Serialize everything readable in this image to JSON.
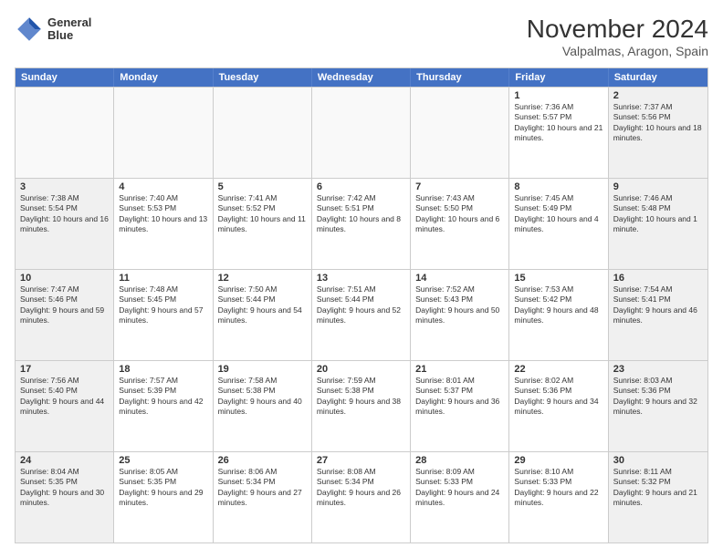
{
  "header": {
    "logo_line1": "General",
    "logo_line2": "Blue",
    "month_title": "November 2024",
    "location": "Valpalmas, Aragon, Spain"
  },
  "weekdays": [
    "Sunday",
    "Monday",
    "Tuesday",
    "Wednesday",
    "Thursday",
    "Friday",
    "Saturday"
  ],
  "rows": [
    [
      {
        "day": "",
        "info": ""
      },
      {
        "day": "",
        "info": ""
      },
      {
        "day": "",
        "info": ""
      },
      {
        "day": "",
        "info": ""
      },
      {
        "day": "",
        "info": ""
      },
      {
        "day": "1",
        "info": "Sunrise: 7:36 AM\nSunset: 5:57 PM\nDaylight: 10 hours and 21 minutes."
      },
      {
        "day": "2",
        "info": "Sunrise: 7:37 AM\nSunset: 5:56 PM\nDaylight: 10 hours and 18 minutes."
      }
    ],
    [
      {
        "day": "3",
        "info": "Sunrise: 7:38 AM\nSunset: 5:54 PM\nDaylight: 10 hours and 16 minutes."
      },
      {
        "day": "4",
        "info": "Sunrise: 7:40 AM\nSunset: 5:53 PM\nDaylight: 10 hours and 13 minutes."
      },
      {
        "day": "5",
        "info": "Sunrise: 7:41 AM\nSunset: 5:52 PM\nDaylight: 10 hours and 11 minutes."
      },
      {
        "day": "6",
        "info": "Sunrise: 7:42 AM\nSunset: 5:51 PM\nDaylight: 10 hours and 8 minutes."
      },
      {
        "day": "7",
        "info": "Sunrise: 7:43 AM\nSunset: 5:50 PM\nDaylight: 10 hours and 6 minutes."
      },
      {
        "day": "8",
        "info": "Sunrise: 7:45 AM\nSunset: 5:49 PM\nDaylight: 10 hours and 4 minutes."
      },
      {
        "day": "9",
        "info": "Sunrise: 7:46 AM\nSunset: 5:48 PM\nDaylight: 10 hours and 1 minute."
      }
    ],
    [
      {
        "day": "10",
        "info": "Sunrise: 7:47 AM\nSunset: 5:46 PM\nDaylight: 9 hours and 59 minutes."
      },
      {
        "day": "11",
        "info": "Sunrise: 7:48 AM\nSunset: 5:45 PM\nDaylight: 9 hours and 57 minutes."
      },
      {
        "day": "12",
        "info": "Sunrise: 7:50 AM\nSunset: 5:44 PM\nDaylight: 9 hours and 54 minutes."
      },
      {
        "day": "13",
        "info": "Sunrise: 7:51 AM\nSunset: 5:44 PM\nDaylight: 9 hours and 52 minutes."
      },
      {
        "day": "14",
        "info": "Sunrise: 7:52 AM\nSunset: 5:43 PM\nDaylight: 9 hours and 50 minutes."
      },
      {
        "day": "15",
        "info": "Sunrise: 7:53 AM\nSunset: 5:42 PM\nDaylight: 9 hours and 48 minutes."
      },
      {
        "day": "16",
        "info": "Sunrise: 7:54 AM\nSunset: 5:41 PM\nDaylight: 9 hours and 46 minutes."
      }
    ],
    [
      {
        "day": "17",
        "info": "Sunrise: 7:56 AM\nSunset: 5:40 PM\nDaylight: 9 hours and 44 minutes."
      },
      {
        "day": "18",
        "info": "Sunrise: 7:57 AM\nSunset: 5:39 PM\nDaylight: 9 hours and 42 minutes."
      },
      {
        "day": "19",
        "info": "Sunrise: 7:58 AM\nSunset: 5:38 PM\nDaylight: 9 hours and 40 minutes."
      },
      {
        "day": "20",
        "info": "Sunrise: 7:59 AM\nSunset: 5:38 PM\nDaylight: 9 hours and 38 minutes."
      },
      {
        "day": "21",
        "info": "Sunrise: 8:01 AM\nSunset: 5:37 PM\nDaylight: 9 hours and 36 minutes."
      },
      {
        "day": "22",
        "info": "Sunrise: 8:02 AM\nSunset: 5:36 PM\nDaylight: 9 hours and 34 minutes."
      },
      {
        "day": "23",
        "info": "Sunrise: 8:03 AM\nSunset: 5:36 PM\nDaylight: 9 hours and 32 minutes."
      }
    ],
    [
      {
        "day": "24",
        "info": "Sunrise: 8:04 AM\nSunset: 5:35 PM\nDaylight: 9 hours and 30 minutes."
      },
      {
        "day": "25",
        "info": "Sunrise: 8:05 AM\nSunset: 5:35 PM\nDaylight: 9 hours and 29 minutes."
      },
      {
        "day": "26",
        "info": "Sunrise: 8:06 AM\nSunset: 5:34 PM\nDaylight: 9 hours and 27 minutes."
      },
      {
        "day": "27",
        "info": "Sunrise: 8:08 AM\nSunset: 5:34 PM\nDaylight: 9 hours and 26 minutes."
      },
      {
        "day": "28",
        "info": "Sunrise: 8:09 AM\nSunset: 5:33 PM\nDaylight: 9 hours and 24 minutes."
      },
      {
        "day": "29",
        "info": "Sunrise: 8:10 AM\nSunset: 5:33 PM\nDaylight: 9 hours and 22 minutes."
      },
      {
        "day": "30",
        "info": "Sunrise: 8:11 AM\nSunset: 5:32 PM\nDaylight: 9 hours and 21 minutes."
      }
    ]
  ]
}
